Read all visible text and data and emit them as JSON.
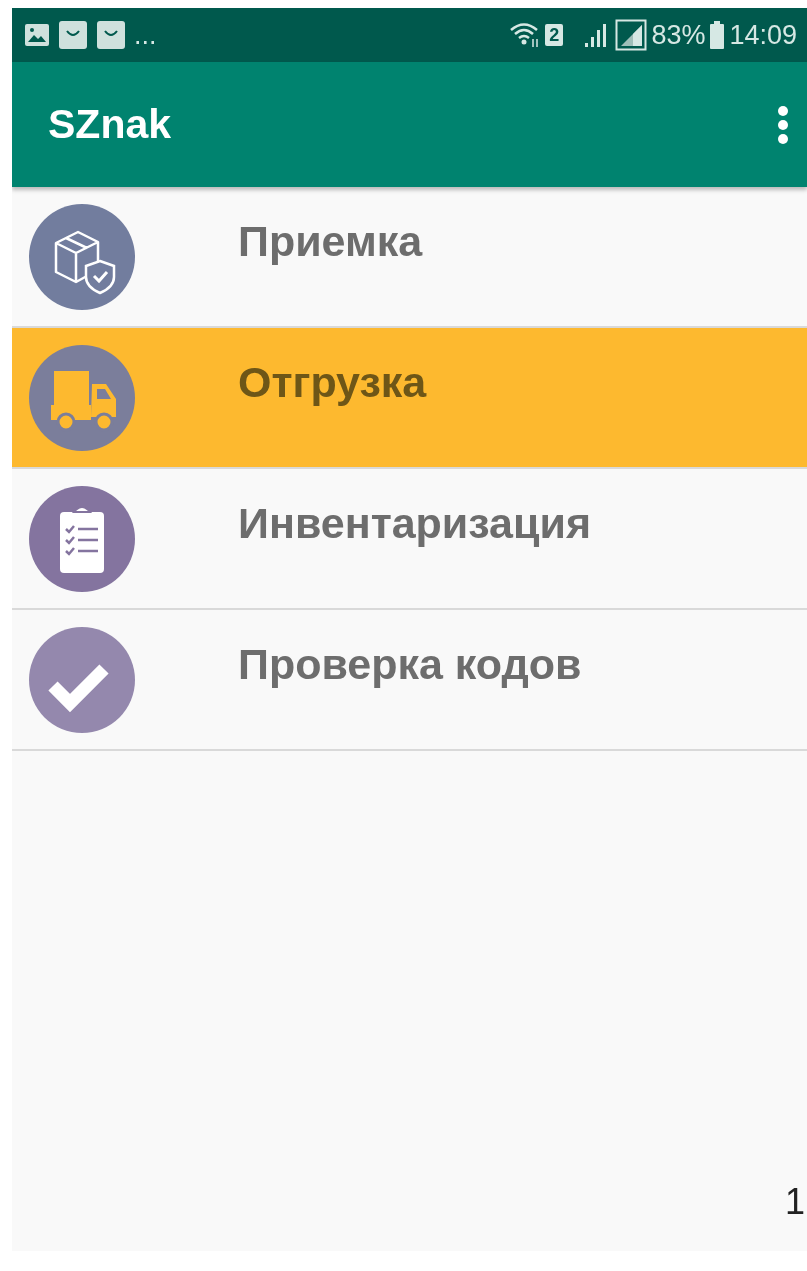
{
  "status_bar": {
    "more": "...",
    "sim": "2",
    "battery": "83%",
    "time": "14:09"
  },
  "app_bar": {
    "title": "SZnak"
  },
  "menu": [
    {
      "kind": "box",
      "label": "Приемка",
      "selected": false
    },
    {
      "kind": "truck",
      "label": "Отгрузка",
      "selected": true
    },
    {
      "kind": "clipboard",
      "label": "Инвентаризация",
      "selected": false
    },
    {
      "kind": "check",
      "label": "Проверка кодов",
      "selected": false
    }
  ],
  "footer": {
    "page_number": "1"
  }
}
